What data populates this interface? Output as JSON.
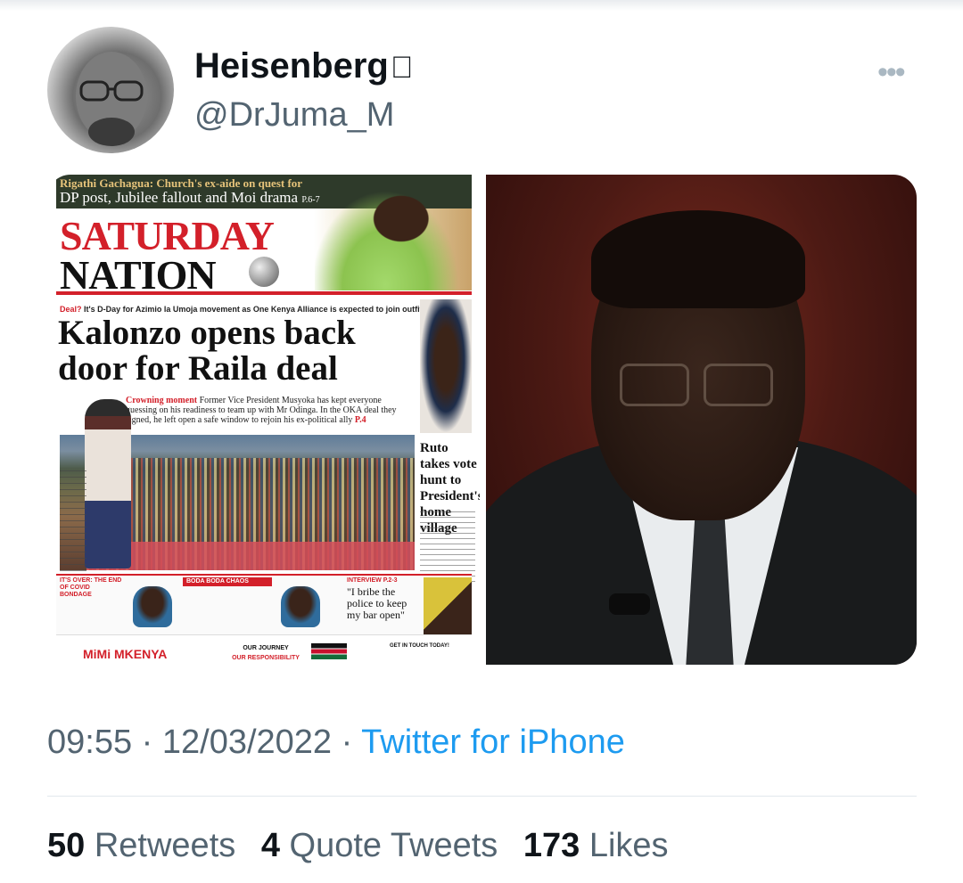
{
  "tweet": {
    "author": {
      "display_name": "Heisenberg",
      "name_emoji": "",
      "handle": "@DrJuma_M"
    },
    "timestamp": {
      "time": "09:55",
      "separator": "·",
      "date": "12/03/2022",
      "source": "Twitter for iPhone"
    },
    "stats": {
      "retweets_count": "50",
      "retweets_label": "Retweets",
      "quotes_count": "4",
      "quotes_label": "Quote Tweets",
      "likes_count": "173",
      "likes_label": "Likes"
    },
    "more_icon": "more-horizontal-icon"
  },
  "newspaper": {
    "top_line1": "Rigathi Gachagua: Church's ex-aide on quest for",
    "top_line2": "DP post, Jubilee fallout and Moi drama",
    "top_page": "P.6-7",
    "mast_line1": "SATURDAY",
    "mast_line2": "NATION",
    "kicker_red": "Deal?",
    "kicker_text": "It's D-Day for Azimio la Umoja movement as One Kenya Alliance is expected to join outfit",
    "headline": "Kalonzo opens back door for Raila deal",
    "caption_red": "Crowning moment",
    "caption_text": "Former Vice President Musyoka has kept everyone guessing on his readiness to team up with Mr Odinga. In the OKA deal they signed, he left open a safe window to rejoin his ex-political ally",
    "caption_page": "P.4",
    "side_headline": "Ruto takes vote hunt to President's home village",
    "bottom1": "IT'S OVER: THE END OF COVID BONDAGE",
    "bottom2": "BODA BODA CHAOS",
    "bottom3": "INTERVIEW P.2-3",
    "quote": "\"I bribe the police to keep my bar open\"",
    "footer_brand_a": "MiMi ",
    "footer_brand_b": "MKENYA",
    "footer_mid1": "OUR JOURNEY",
    "footer_mid2": "OUR RESPONSIBILITY",
    "footer_touch": "GET IN TOUCH TODAY!"
  },
  "colors": {
    "link_blue": "#1d9bf0",
    "secondary_text": "#536471",
    "primary_text": "#0f1419",
    "nation_red": "#d3202a"
  }
}
